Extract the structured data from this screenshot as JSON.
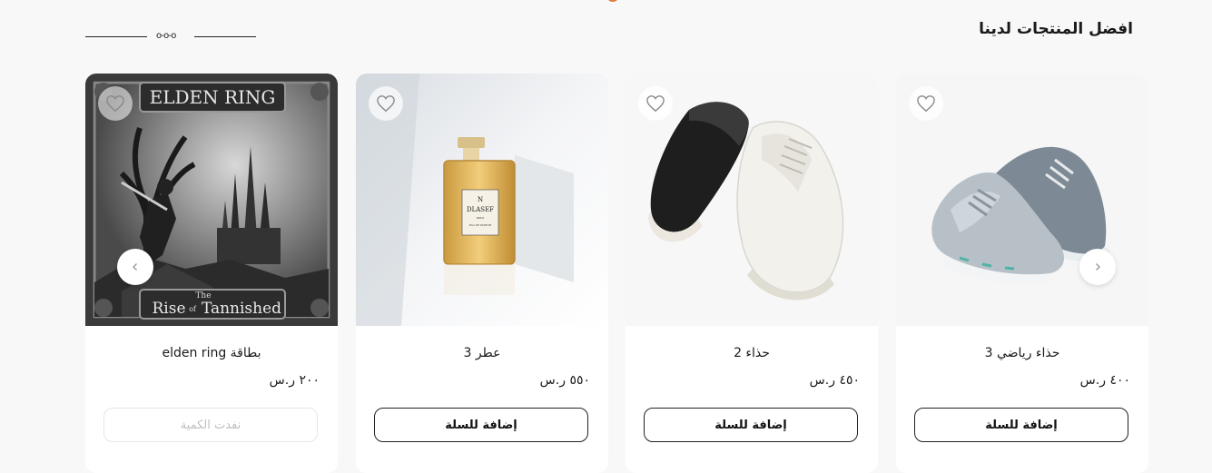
{
  "section": {
    "title": "افضل المنتجات لدينا"
  },
  "products": [
    {
      "name": "بطاقة elden ring",
      "price": "٢٠٠ ر.س",
      "button": "نفدت الكمية",
      "image": "elden-ring-card-art"
    },
    {
      "name": "عطر 3",
      "price": "٥٥٠ ر.س",
      "button": "إضافة للسلة",
      "image": "perfume-bottle"
    },
    {
      "name": "حذاء 2",
      "price": "٤٥٠ ر.س",
      "button": "إضافة للسلة",
      "image": "leather-shoes"
    },
    {
      "name": "حذاء رياضي 3",
      "price": "٤٠٠ ر.س",
      "button": "إضافة للسلة",
      "image": "sneakers"
    }
  ],
  "artwork": {
    "elden_title": "ELDEN RING",
    "elden_sub_1": "The",
    "elden_sub_2": "Rise",
    "elden_sub_3": "of",
    "elden_sub_4": "Tannished",
    "perfume_l1": "N",
    "perfume_l2": "DLASEF",
    "perfume_l3": "PARIS",
    "perfume_l4": "EAU DE PARFUM"
  },
  "icons": {
    "heart": "heart-icon",
    "prev": "chevron-left-icon",
    "next": "chevron-right-icon"
  },
  "colors": {
    "accent": "#e07a3b",
    "text": "#1a1a1a",
    "disabled": "#bfbfbf"
  }
}
